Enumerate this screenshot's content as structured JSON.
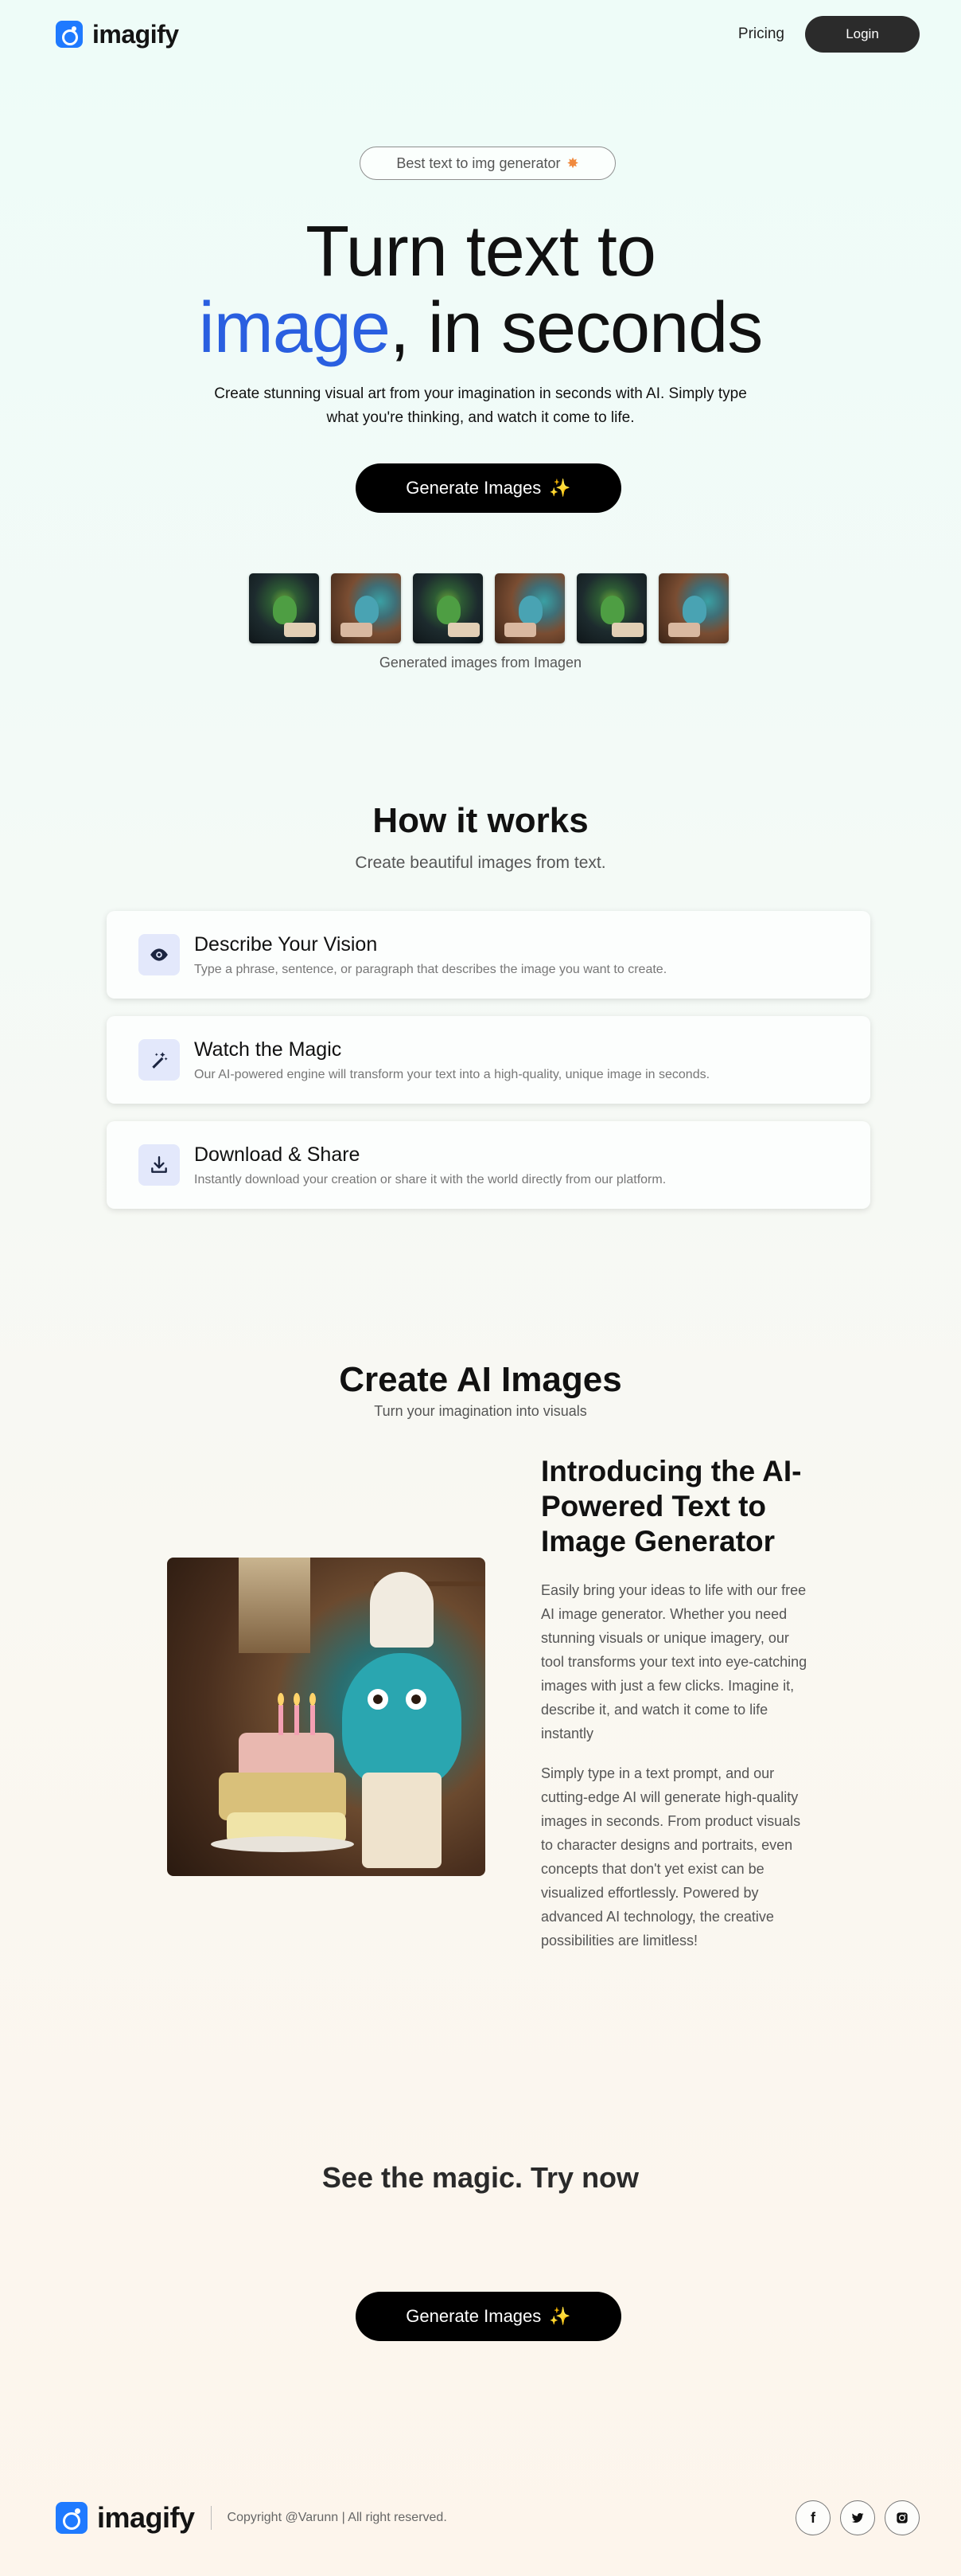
{
  "nav": {
    "logo_text": "imagify",
    "pricing": "Pricing",
    "login": "Login"
  },
  "hero": {
    "badge": "Best text to img generator",
    "title_line1": "Turn text to",
    "title_highlight": "image",
    "title_rest": ", in seconds",
    "subtitle": "Create stunning visual art from your imagination in seconds with AI. Simply type what you're thinking, and watch it come to life.",
    "cta": "Generate Images",
    "thumbs_caption": "Generated images from Imagen"
  },
  "how": {
    "title": "How it works",
    "subtitle": "Create beautiful images from text.",
    "steps": [
      {
        "title": "Describe Your Vision",
        "desc": "Type a phrase, sentence, or paragraph that describes the image you want to create.",
        "icon": "eye-icon"
      },
      {
        "title": "Watch the Magic",
        "desc": "Our AI-powered engine will transform your text into a high-quality, unique image in seconds.",
        "icon": "magic-wand-icon"
      },
      {
        "title": "Download & Share",
        "desc": "Instantly download your creation or share it with the world directly from our platform.",
        "icon": "download-icon"
      }
    ]
  },
  "create": {
    "title": "Create AI Images",
    "subtitle": "Turn your imagination into visuals",
    "intro_title": "Introducing the AI-Powered Text to Image Generator",
    "p1": "Easily bring your ideas to life with our free AI image generator. Whether you need stunning visuals or unique imagery, our tool transforms your text into eye-catching images with just a few clicks. Imagine it, describe it, and watch it come to life instantly",
    "p2": "Simply type in a text prompt, and our cutting-edge AI will generate high-quality images in seconds. From product visuals to character designs and portraits, even concepts that don't yet exist can be visualized effortlessly. Powered by advanced AI technology, the creative possibilities are limitless!"
  },
  "try": {
    "title": "See the magic. Try now",
    "cta": "Generate Images"
  },
  "footer": {
    "logo_text": "imagify",
    "copyright": "Copyright @Varunn | All right reserved.",
    "socials": [
      {
        "icon": "facebook-icon",
        "glyph": "f"
      },
      {
        "icon": "twitter-icon",
        "glyph": "t"
      },
      {
        "icon": "instagram-icon",
        "glyph": "ig"
      }
    ]
  },
  "colors": {
    "accent": "#2a5fe0",
    "logo": "#1f7aff",
    "cta": "#000000"
  }
}
